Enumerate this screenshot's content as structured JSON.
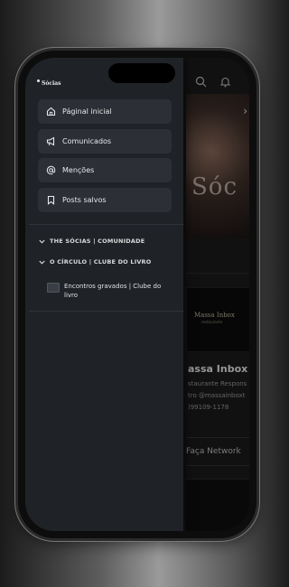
{
  "brand": {
    "name": "Sócias"
  },
  "nav": {
    "items": [
      {
        "label": "Páginal inicial",
        "icon": "home-icon"
      },
      {
        "label": "Comunicados",
        "icon": "megaphone-icon"
      },
      {
        "label": "Menções",
        "icon": "at-icon"
      },
      {
        "label": "Posts salvos",
        "icon": "bookmark-icon"
      }
    ]
  },
  "groups": [
    {
      "title": "THE SÓCIAS | COMUNIDADE",
      "expanded": false
    },
    {
      "title": "O CÍRCULO | CLUBE DO LIVRO",
      "expanded": true,
      "children": [
        {
          "label": "Encontros gravados | Clube do livro"
        }
      ]
    }
  ],
  "background": {
    "hero_text": "Sóc",
    "card_logo": "Massa Inbox",
    "card_logo_sub": "restaurante",
    "title": "assa Inbox",
    "lines": [
      "staurante Respons",
      "tro @massainboxt",
      ")99109-1178"
    ],
    "button_label": "Faça Network"
  },
  "colors": {
    "drawer": "#1f2226",
    "item": "#2c3036",
    "text": "#e6e8ea"
  }
}
